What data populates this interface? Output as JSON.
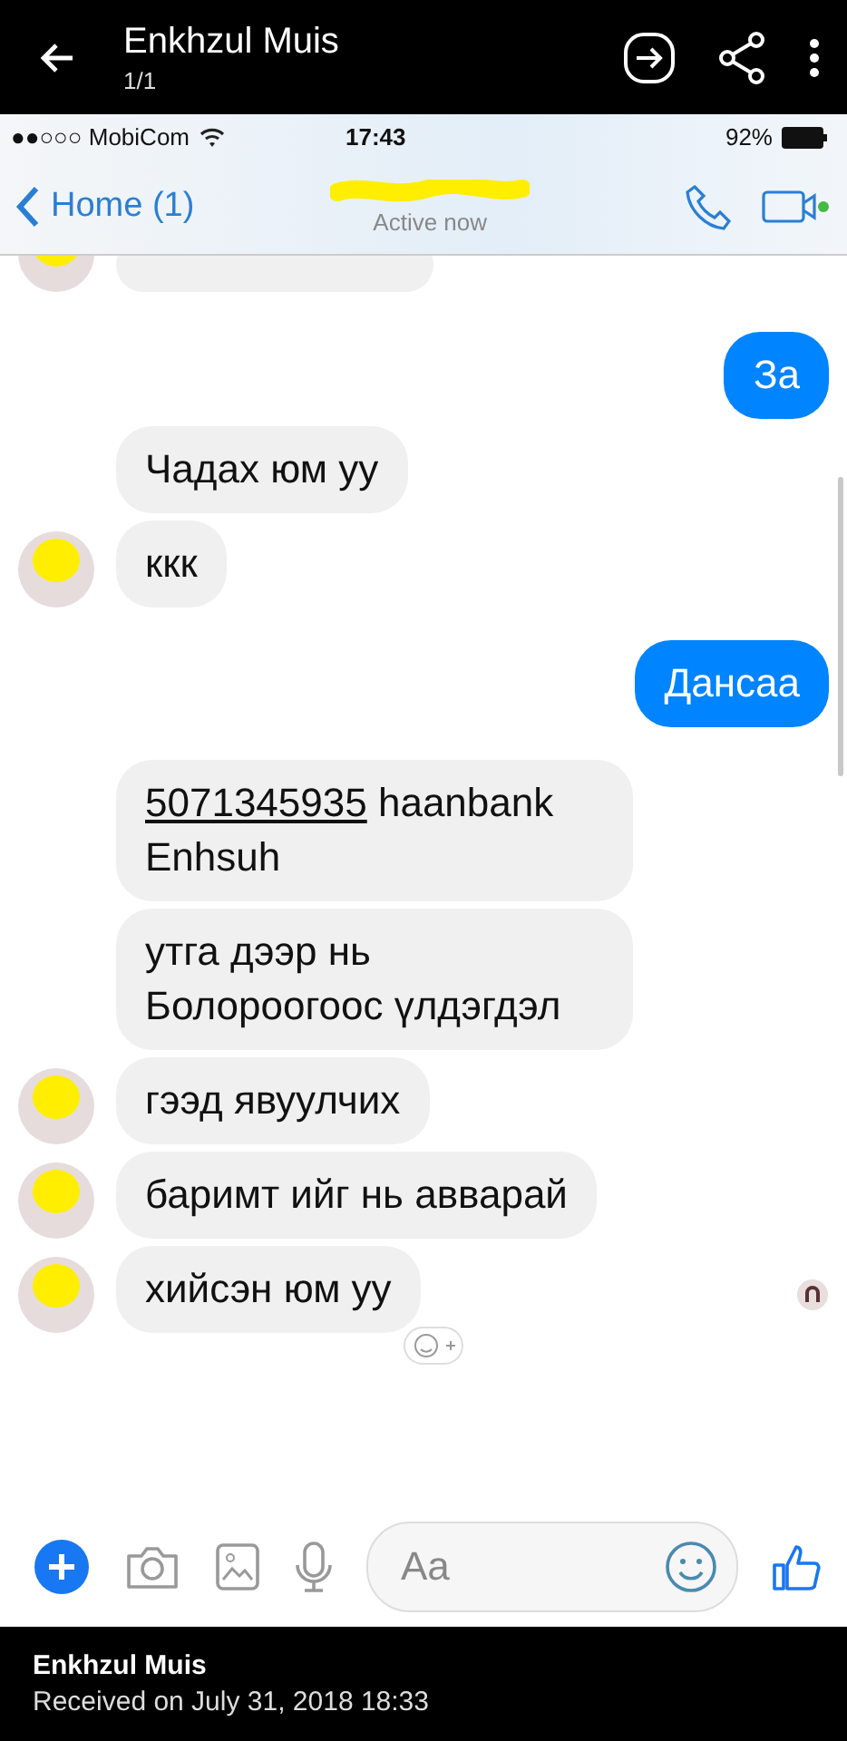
{
  "viewer": {
    "title": "Enkhzul Muis",
    "counter": "1/1"
  },
  "status_bar": {
    "carrier": "●●○○○ MobiCom",
    "time": "17:43",
    "battery": "92%"
  },
  "nav": {
    "back": "Home (1)",
    "subtitle": "Active now"
  },
  "messages": [
    {
      "kind": "incoming",
      "avatar": false,
      "text": "Чадах юм уу"
    },
    {
      "kind": "incoming",
      "avatar": true,
      "text": "ккк"
    },
    {
      "kind": "outgoing",
      "avatar": false,
      "text": "Дансаа"
    },
    {
      "kind": "incoming",
      "avatar": false,
      "link": "5071345935",
      "text": " haanbank Enhsuh"
    },
    {
      "kind": "incoming",
      "avatar": false,
      "text": "утга дээр нь Болороогоос үлдэгдэл"
    },
    {
      "kind": "incoming",
      "avatar": true,
      "text": "гээд явуулчих"
    },
    {
      "kind": "incoming",
      "avatar": true,
      "text": "баримт ийг нь авварай"
    },
    {
      "kind": "incoming",
      "avatar": true,
      "text": "хийсэн юм уу"
    }
  ],
  "first_outgoing": "За",
  "composer": {
    "placeholder": "Aa"
  },
  "footer": {
    "sender": "Enkhzul Muis",
    "received": "Received on July 31, 2018 18:33"
  }
}
